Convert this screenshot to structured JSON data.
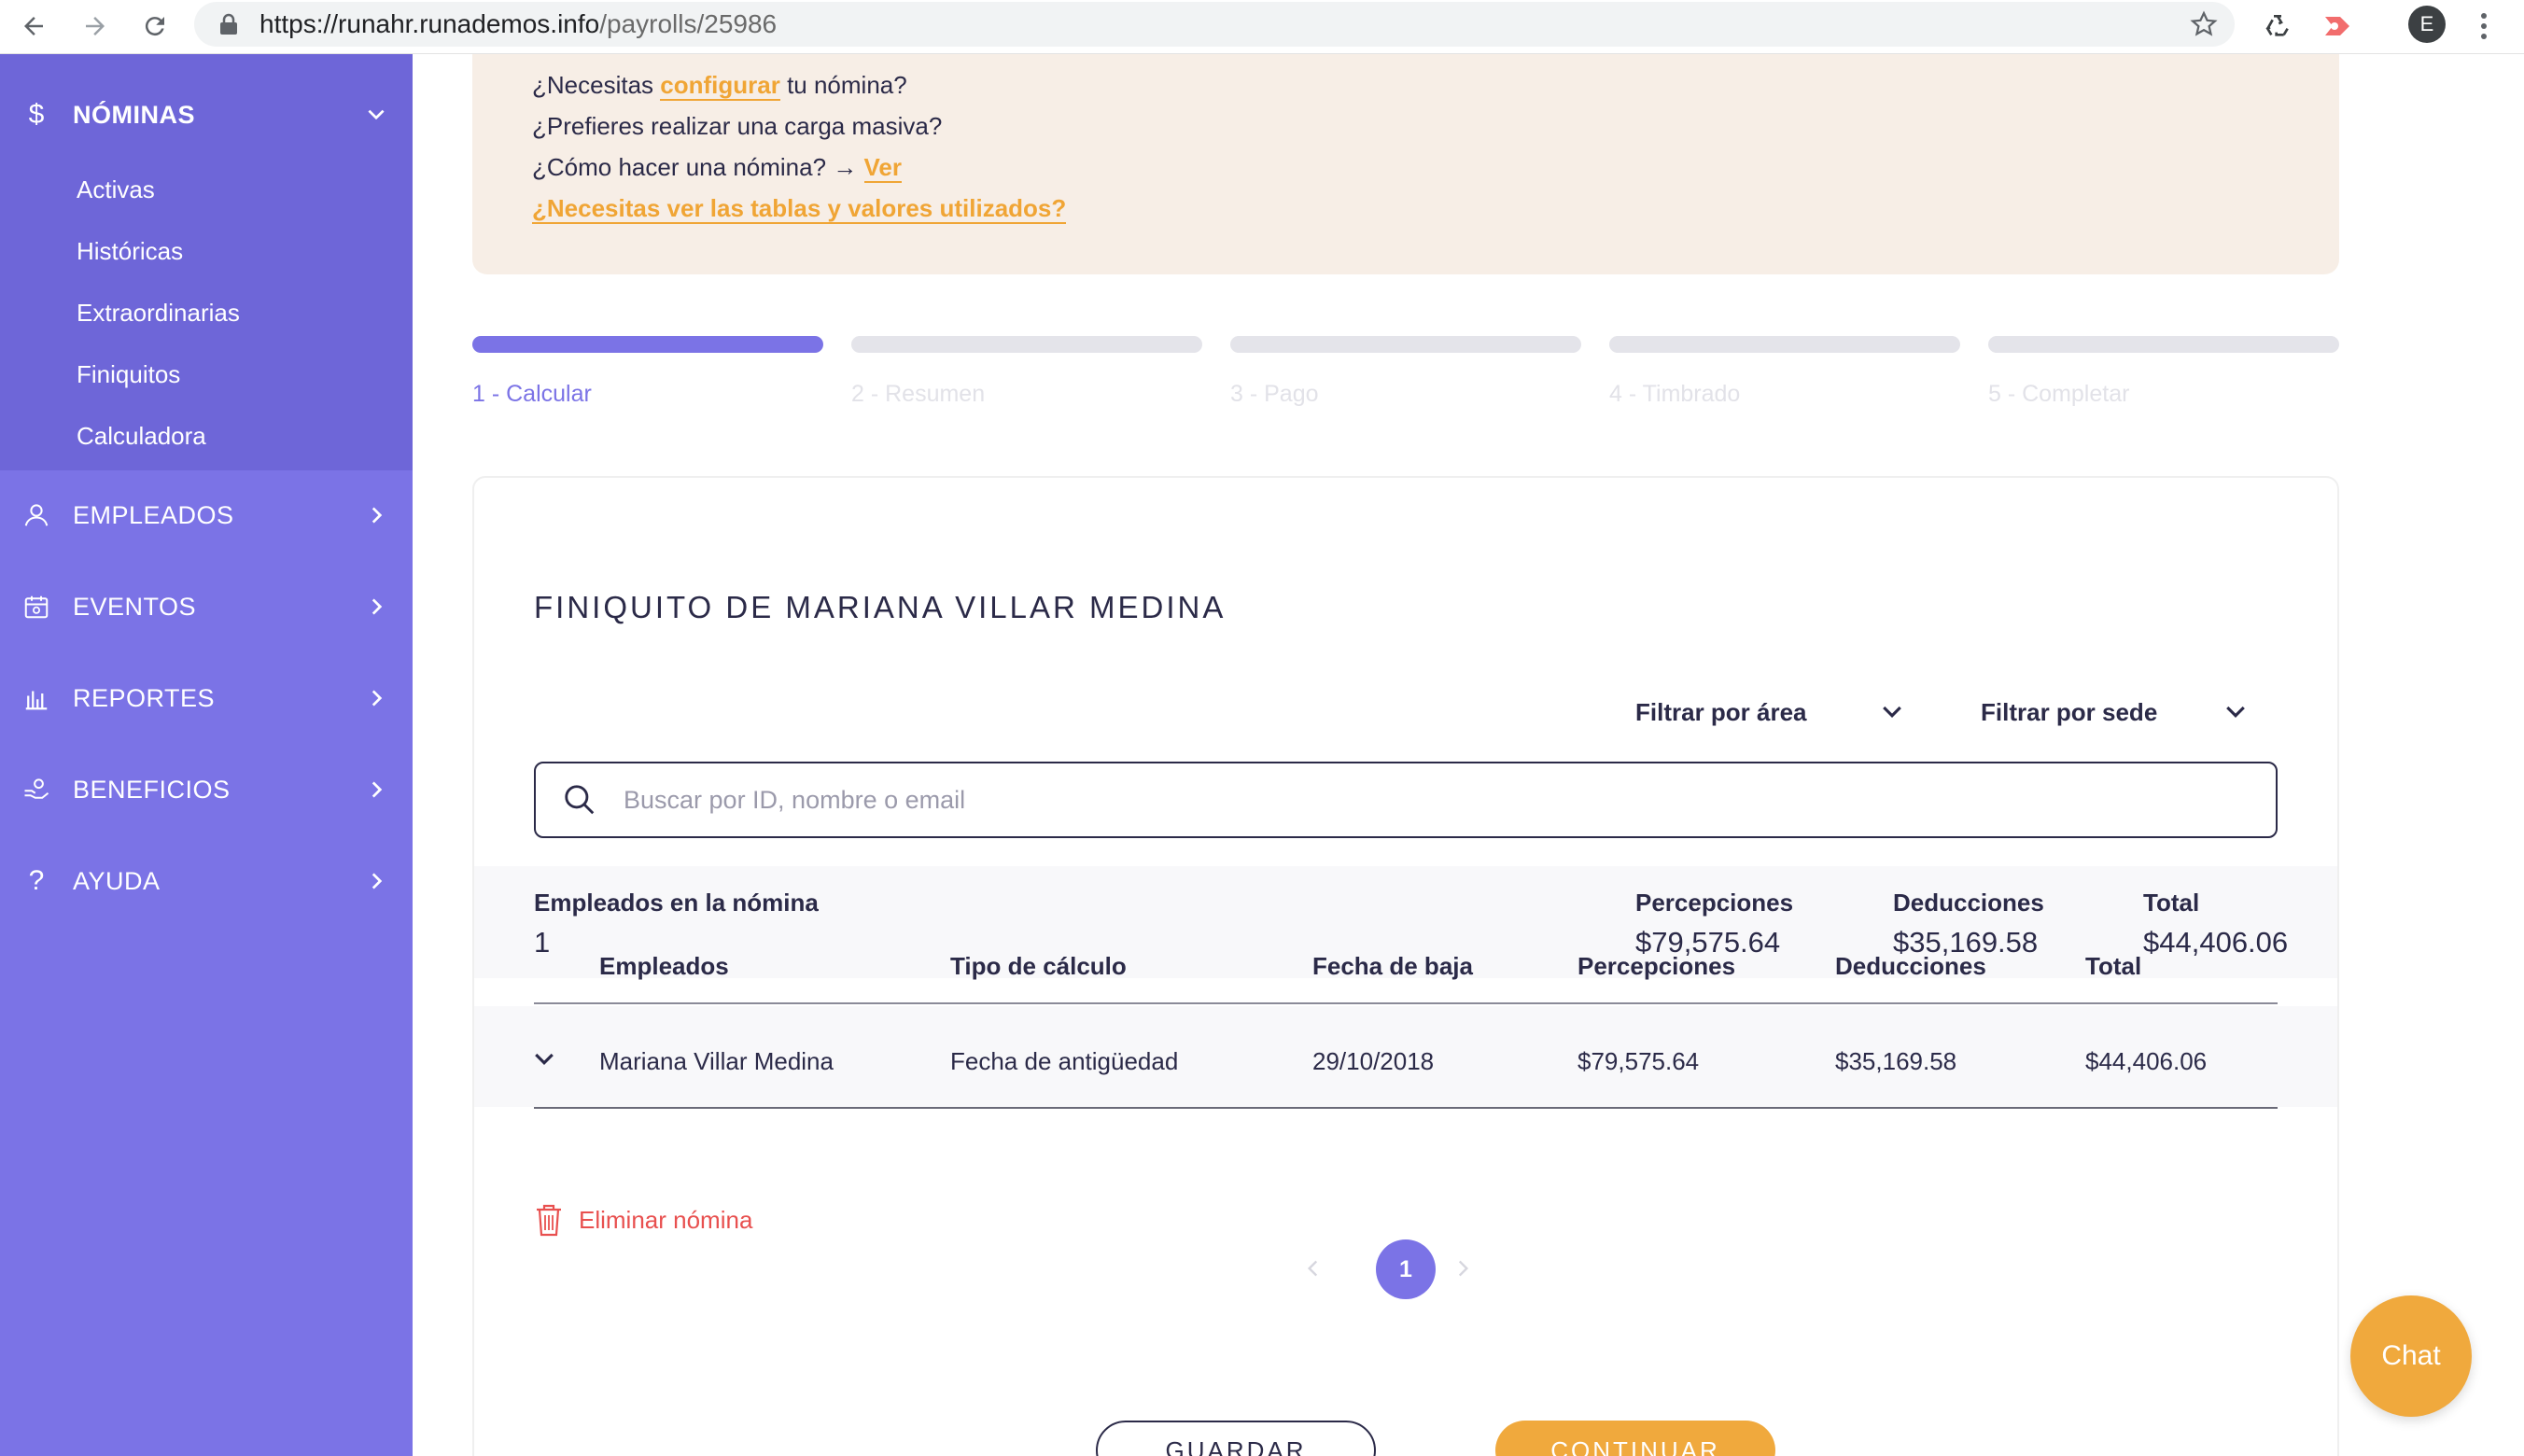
{
  "browser": {
    "url_host": "https://runahr.runademos.info",
    "url_path": "/payrolls/25986",
    "profile_initial": "E"
  },
  "sidebar": {
    "nominas": {
      "label": "NÓMINAS",
      "items": [
        "Activas",
        "Históricas",
        "Extraordinarias",
        "Finiquitos",
        "Calculadora"
      ]
    },
    "sections": [
      {
        "label": "EMPLEADOS",
        "icon": "user-icon"
      },
      {
        "label": "EVENTOS",
        "icon": "calendar-icon"
      },
      {
        "label": "REPORTES",
        "icon": "bar-chart-icon"
      },
      {
        "label": "BENEFICIOS",
        "icon": "hand-coin-icon"
      },
      {
        "label": "AYUDA",
        "icon": "question-icon"
      }
    ]
  },
  "info": {
    "line1_pre": "¿Necesitas ",
    "line1_link": "configurar",
    "line1_post": " tu nómina?",
    "line2": "¿Prefieres realizar una carga masiva?",
    "line3_pre": "¿Cómo hacer una nómina? → ",
    "line3_link": "Ver",
    "line4_link": "¿Necesitas ver las tablas y valores utilizados?"
  },
  "steps": [
    "1 - Calcular",
    "2 - Resumen",
    "3 - Pago",
    "4 - Timbrado",
    "5 - Completar"
  ],
  "card": {
    "title": "FINIQUITO DE MARIANA VILLAR MEDINA",
    "filter_area": "Filtrar por área",
    "filter_sede": "Filtrar por sede",
    "search_placeholder": "Buscar por ID, nombre o email"
  },
  "summary": {
    "employees_label": "Empleados en la nómina",
    "employees_value": "1",
    "perceptions_label": "Percepciones",
    "perceptions_value": "$79,575.64",
    "deductions_label": "Deducciones",
    "deductions_value": "$35,169.58",
    "total_label": "Total",
    "total_value": "$44,406.06"
  },
  "table": {
    "headers": [
      "Empleados",
      "Tipo de cálculo",
      "Fecha de baja",
      "Percepciones",
      "Deducciones",
      "Total"
    ],
    "rows": [
      [
        "Mariana Villar Medina",
        "Fecha de antigüedad",
        "29/10/2018",
        "$79,575.64",
        "$35,169.58",
        "$44,406.06"
      ]
    ]
  },
  "actions": {
    "delete_label": "Eliminar nómina",
    "page": "1",
    "save_label": "GUARDAR",
    "continue_label": "CONTINUAR"
  },
  "chat_label": "Chat",
  "colors": {
    "primary": "#7b73e6",
    "accent": "#f0a93d",
    "danger": "#e8504f",
    "text": "#2b2a48"
  }
}
